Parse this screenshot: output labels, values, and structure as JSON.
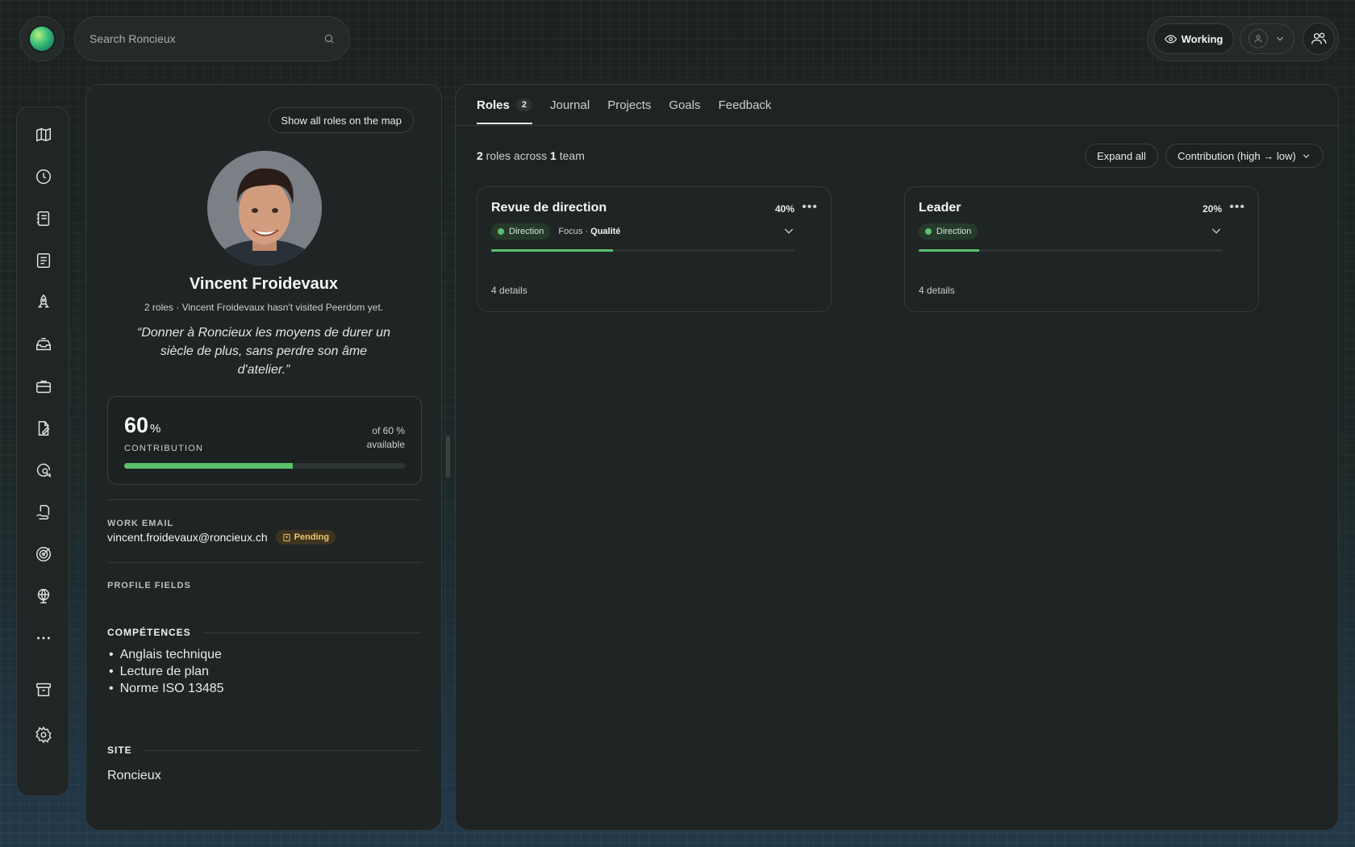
{
  "search": {
    "placeholder": "Search Roncieux"
  },
  "header": {
    "status_label": "Working"
  },
  "sidebar": {
    "items": [
      {
        "icon": "map-icon"
      },
      {
        "icon": "clock-icon"
      },
      {
        "icon": "journal-icon"
      },
      {
        "icon": "list-icon"
      },
      {
        "icon": "rocket-icon"
      },
      {
        "icon": "inbox-icon"
      },
      {
        "icon": "briefcase-icon"
      },
      {
        "icon": "edit-document-icon"
      },
      {
        "icon": "search-chat-icon"
      },
      {
        "icon": "hand-document-icon"
      },
      {
        "icon": "target-icon"
      },
      {
        "icon": "globe-icon"
      },
      {
        "icon": "more-icon"
      },
      {
        "icon": "archive-icon"
      },
      {
        "icon": "settings-icon"
      }
    ]
  },
  "profile": {
    "show_roles_label": "Show all roles on the map",
    "name": "Vincent Froidevaux",
    "subline": "2 roles · Vincent Froidevaux hasn't visited Peerdom yet.",
    "quote": "“Donner à Roncieux les moyens de durer un siècle de plus, sans perdre son âme d'atelier.”",
    "contribution": {
      "value": "60",
      "unit": "%",
      "label": "CONTRIBUTION",
      "of_line1": "of 60 %",
      "of_line2": "available",
      "fill_fraction": 0.6
    },
    "work_email_label": "WORK EMAIL",
    "work_email": "vincent.froidevaux@roncieux.ch",
    "pending_label": "Pending",
    "profile_fields_label": "PROFILE FIELDS",
    "competences_label": "COMPÉTENCES",
    "competences": [
      "Anglais technique",
      "Lecture de plan",
      "Norme ISO 13485"
    ],
    "site_label": "SITE",
    "site_value": "Roncieux"
  },
  "main": {
    "tabs": [
      {
        "label": "Roles",
        "count": "2"
      },
      {
        "label": "Journal"
      },
      {
        "label": "Projects"
      },
      {
        "label": "Goals"
      },
      {
        "label": "Feedback"
      }
    ],
    "summary": {
      "roles_count": "2",
      "roles_text": " roles across ",
      "team_count": "1",
      "team_text": " team"
    },
    "expand_all_label": "Expand all",
    "sort_label": "Contribution (high → low)",
    "roles": [
      {
        "title": "Revue de direction",
        "percent": "40%",
        "fill_fraction": 0.4,
        "circle": "Direction",
        "focus_prefix": "Focus · ",
        "focus_value": "Qualité",
        "details": "4 details"
      },
      {
        "title": "Leader",
        "percent": "20%",
        "fill_fraction": 0.2,
        "circle": "Direction",
        "details": "4 details"
      }
    ]
  },
  "colors": {
    "accent_green": "#5bbf6c",
    "pending_text": "#f2c66a"
  }
}
